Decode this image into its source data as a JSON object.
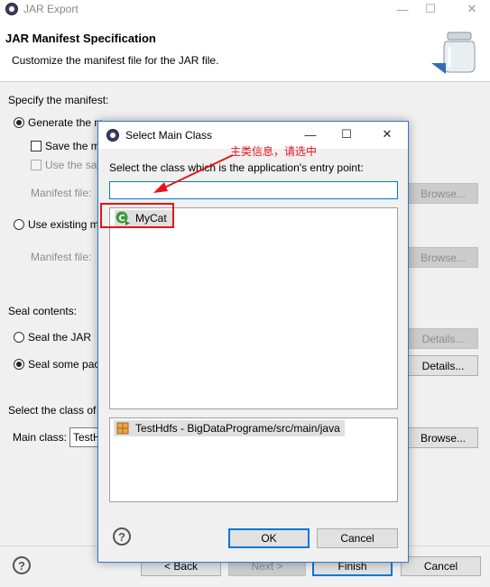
{
  "window": {
    "title": "JAR Export",
    "minimize": "—",
    "maximize": "☐",
    "close": "✕"
  },
  "header": {
    "title": "JAR Manifest Specification",
    "description": "Customize the manifest file for the JAR file."
  },
  "manifest": {
    "section_label": "Specify the manifest:",
    "generate_label": "Generate the m",
    "save_label": "Save the m",
    "use_saved_label": "Use the sav",
    "manifest_file_label_1": "Manifest file:",
    "browse_1": "Browse...",
    "use_existing_label": "Use existing ma",
    "manifest_file_label_2": "Manifest file:",
    "browse_2": "Browse..."
  },
  "seal": {
    "section_label": "Seal contents:",
    "seal_jar_label": "Seal the JAR",
    "details_1": "Details...",
    "seal_some_label": "Seal some pack",
    "details_2": "Details..."
  },
  "main_class": {
    "section_label": "Select the class of t",
    "label": "Main class:",
    "value": "TestH",
    "browse": "Browse..."
  },
  "footer": {
    "help": "?",
    "back": "< Back",
    "next": "Next >",
    "finish": "Finish",
    "cancel": "Cancel"
  },
  "dialog": {
    "title": "Select Main Class",
    "minimize": "—",
    "maximize": "☐",
    "close": "✕",
    "prompt": "Select the class which is the application's entry point:",
    "filter_value": "",
    "class_items": [
      "MyCat"
    ],
    "package_items": [
      "TestHdfs - BigDataPrograme/src/main/java"
    ],
    "help": "?",
    "ok": "OK",
    "cancel": "Cancel"
  },
  "annotation": {
    "text": "主类信息，请选中",
    "color": "#e8121c"
  }
}
